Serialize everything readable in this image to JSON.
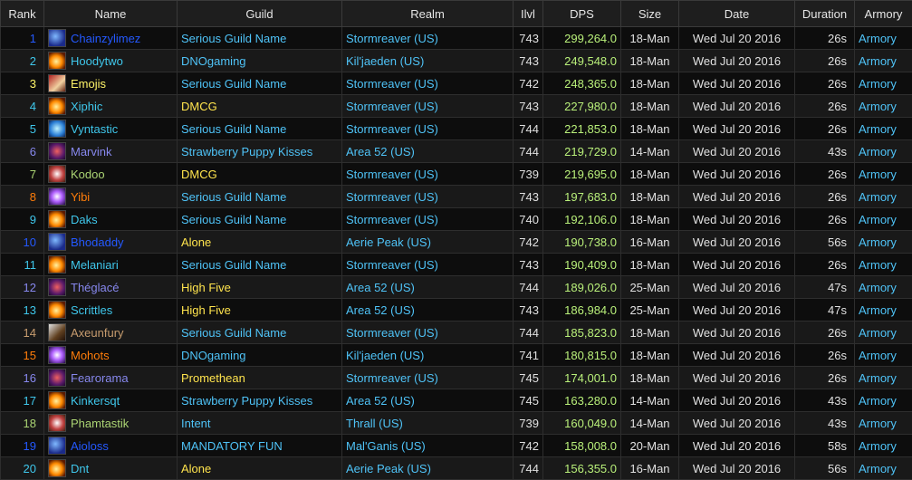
{
  "headers": [
    "Rank",
    "Name",
    "Guild",
    "Realm",
    "Ilvl",
    "DPS",
    "Size",
    "Date",
    "Duration",
    "Armory"
  ],
  "colors": {
    "mage": "#3fc7eb",
    "shaman": "#2459ff",
    "warlock": "#8788ee",
    "priest": "#f0f0f0",
    "hunter": "#abd473",
    "rogue": "#fff569",
    "paladin": "#f58cba",
    "druid": "#ff7d0a",
    "dk": "#c41f3b",
    "dh": "#a330c9",
    "warrior": "#c79c6e",
    "link": "#4fc3f7",
    "guild_alt": "#ffe44d",
    "dps": "#b9f07a"
  },
  "rows": [
    {
      "rank": "1",
      "name": "Chainzylimez",
      "cls": "shaman",
      "icon": "lightning-icon",
      "guild": "Serious Guild Name",
      "gy": false,
      "realm": "Stormreaver (US)",
      "ilvl": "743",
      "dps": "299,264.0",
      "size": "18-Man",
      "date": "Wed Jul 20 2016",
      "dur": "26s",
      "armory": "Armory"
    },
    {
      "rank": "2",
      "name": "Hoodytwo",
      "cls": "mage",
      "icon": "fireball-icon",
      "guild": "DNOgaming",
      "gy": false,
      "realm": "Kil'jaeden (US)",
      "ilvl": "743",
      "dps": "249,548.0",
      "size": "18-Man",
      "date": "Wed Jul 20 2016",
      "dur": "26s",
      "armory": "Armory"
    },
    {
      "rank": "3",
      "name": "Emojis",
      "cls": "rogue",
      "icon": "rogue-icon",
      "guild": "Serious Guild Name",
      "gy": false,
      "realm": "Stormreaver (US)",
      "ilvl": "742",
      "dps": "248,365.0",
      "size": "18-Man",
      "date": "Wed Jul 20 2016",
      "dur": "26s",
      "armory": "Armory"
    },
    {
      "rank": "4",
      "name": "Xiphic",
      "cls": "mage",
      "icon": "fireball-icon",
      "guild": "DMCG",
      "gy": true,
      "realm": "Stormreaver (US)",
      "ilvl": "743",
      "dps": "227,980.0",
      "size": "18-Man",
      "date": "Wed Jul 20 2016",
      "dur": "26s",
      "armory": "Armory"
    },
    {
      "rank": "5",
      "name": "Vyntastic",
      "cls": "mage",
      "icon": "frost-icon",
      "guild": "Serious Guild Name",
      "gy": false,
      "realm": "Stormreaver (US)",
      "ilvl": "744",
      "dps": "221,853.0",
      "size": "18-Man",
      "date": "Wed Jul 20 2016",
      "dur": "26s",
      "armory": "Armory"
    },
    {
      "rank": "6",
      "name": "Marvink",
      "cls": "warlock",
      "icon": "warlock-icon",
      "guild": "Strawberry Puppy Kisses",
      "gy": false,
      "realm": "Area 52 (US)",
      "ilvl": "744",
      "dps": "219,729.0",
      "size": "14-Man",
      "date": "Wed Jul 20 2016",
      "dur": "43s",
      "armory": "Armory"
    },
    {
      "rank": "7",
      "name": "Kodoo",
      "cls": "hunter",
      "icon": "hunter-icon",
      "guild": "DMCG",
      "gy": true,
      "realm": "Stormreaver (US)",
      "ilvl": "739",
      "dps": "219,695.0",
      "size": "18-Man",
      "date": "Wed Jul 20 2016",
      "dur": "26s",
      "armory": "Armory"
    },
    {
      "rank": "8",
      "name": "Yibi",
      "cls": "druid",
      "icon": "arcane-icon",
      "guild": "Serious Guild Name",
      "gy": false,
      "realm": "Stormreaver (US)",
      "ilvl": "743",
      "dps": "197,683.0",
      "size": "18-Man",
      "date": "Wed Jul 20 2016",
      "dur": "26s",
      "armory": "Armory"
    },
    {
      "rank": "9",
      "name": "Daks",
      "cls": "mage",
      "icon": "fireball-icon",
      "guild": "Serious Guild Name",
      "gy": false,
      "realm": "Stormreaver (US)",
      "ilvl": "740",
      "dps": "192,106.0",
      "size": "18-Man",
      "date": "Wed Jul 20 2016",
      "dur": "26s",
      "armory": "Armory"
    },
    {
      "rank": "10",
      "name": "Bhodaddy",
      "cls": "shaman",
      "icon": "lightning-icon",
      "guild": "Alone",
      "gy": true,
      "realm": "Aerie Peak (US)",
      "ilvl": "742",
      "dps": "190,738.0",
      "size": "16-Man",
      "date": "Wed Jul 20 2016",
      "dur": "56s",
      "armory": "Armory"
    },
    {
      "rank": "11",
      "name": "Melaniari",
      "cls": "mage",
      "icon": "fireball-icon",
      "guild": "Serious Guild Name",
      "gy": false,
      "realm": "Stormreaver (US)",
      "ilvl": "743",
      "dps": "190,409.0",
      "size": "18-Man",
      "date": "Wed Jul 20 2016",
      "dur": "26s",
      "armory": "Armory"
    },
    {
      "rank": "12",
      "name": "Théglacé",
      "cls": "warlock",
      "icon": "warlock-icon",
      "guild": "High Five",
      "gy": true,
      "realm": "Area 52 (US)",
      "ilvl": "744",
      "dps": "189,026.0",
      "size": "25-Man",
      "date": "Wed Jul 20 2016",
      "dur": "47s",
      "armory": "Armory"
    },
    {
      "rank": "13",
      "name": "Scrittles",
      "cls": "mage",
      "icon": "fireball-icon",
      "guild": "High Five",
      "gy": true,
      "realm": "Area 52 (US)",
      "ilvl": "743",
      "dps": "186,984.0",
      "size": "25-Man",
      "date": "Wed Jul 20 2016",
      "dur": "47s",
      "armory": "Armory"
    },
    {
      "rank": "14",
      "name": "Axeunfury",
      "cls": "warrior",
      "icon": "warrior-icon",
      "guild": "Serious Guild Name",
      "gy": false,
      "realm": "Stormreaver (US)",
      "ilvl": "744",
      "dps": "185,823.0",
      "size": "18-Man",
      "date": "Wed Jul 20 2016",
      "dur": "26s",
      "armory": "Armory"
    },
    {
      "rank": "15",
      "name": "Mohots",
      "cls": "druid",
      "icon": "arcane-icon",
      "guild": "DNOgaming",
      "gy": false,
      "realm": "Kil'jaeden (US)",
      "ilvl": "741",
      "dps": "180,815.0",
      "size": "18-Man",
      "date": "Wed Jul 20 2016",
      "dur": "26s",
      "armory": "Armory"
    },
    {
      "rank": "16",
      "name": "Fearorama",
      "cls": "warlock",
      "icon": "warlock-icon",
      "guild": "Promethean",
      "gy": true,
      "realm": "Stormreaver (US)",
      "ilvl": "745",
      "dps": "174,001.0",
      "size": "18-Man",
      "date": "Wed Jul 20 2016",
      "dur": "26s",
      "armory": "Armory"
    },
    {
      "rank": "17",
      "name": "Kinkersqt",
      "cls": "mage",
      "icon": "fireball-icon",
      "guild": "Strawberry Puppy Kisses",
      "gy": false,
      "realm": "Area 52 (US)",
      "ilvl": "745",
      "dps": "163,280.0",
      "size": "14-Man",
      "date": "Wed Jul 20 2016",
      "dur": "43s",
      "armory": "Armory"
    },
    {
      "rank": "18",
      "name": "Phamtastik",
      "cls": "hunter",
      "icon": "hunter-icon",
      "guild": "Intent",
      "gy": false,
      "realm": "Thrall (US)",
      "ilvl": "739",
      "dps": "160,049.0",
      "size": "14-Man",
      "date": "Wed Jul 20 2016",
      "dur": "43s",
      "armory": "Armory"
    },
    {
      "rank": "19",
      "name": "Aioloss",
      "cls": "shaman",
      "icon": "lightning-icon",
      "guild": "MANDATORY FUN",
      "gy": false,
      "realm": "Mal'Ganis (US)",
      "ilvl": "742",
      "dps": "158,008.0",
      "size": "20-Man",
      "date": "Wed Jul 20 2016",
      "dur": "58s",
      "armory": "Armory"
    },
    {
      "rank": "20",
      "name": "Dnt",
      "cls": "mage",
      "icon": "fireball-icon",
      "guild": "Alone",
      "gy": true,
      "realm": "Aerie Peak (US)",
      "ilvl": "744",
      "dps": "156,355.0",
      "size": "16-Man",
      "date": "Wed Jul 20 2016",
      "dur": "56s",
      "armory": "Armory"
    }
  ]
}
